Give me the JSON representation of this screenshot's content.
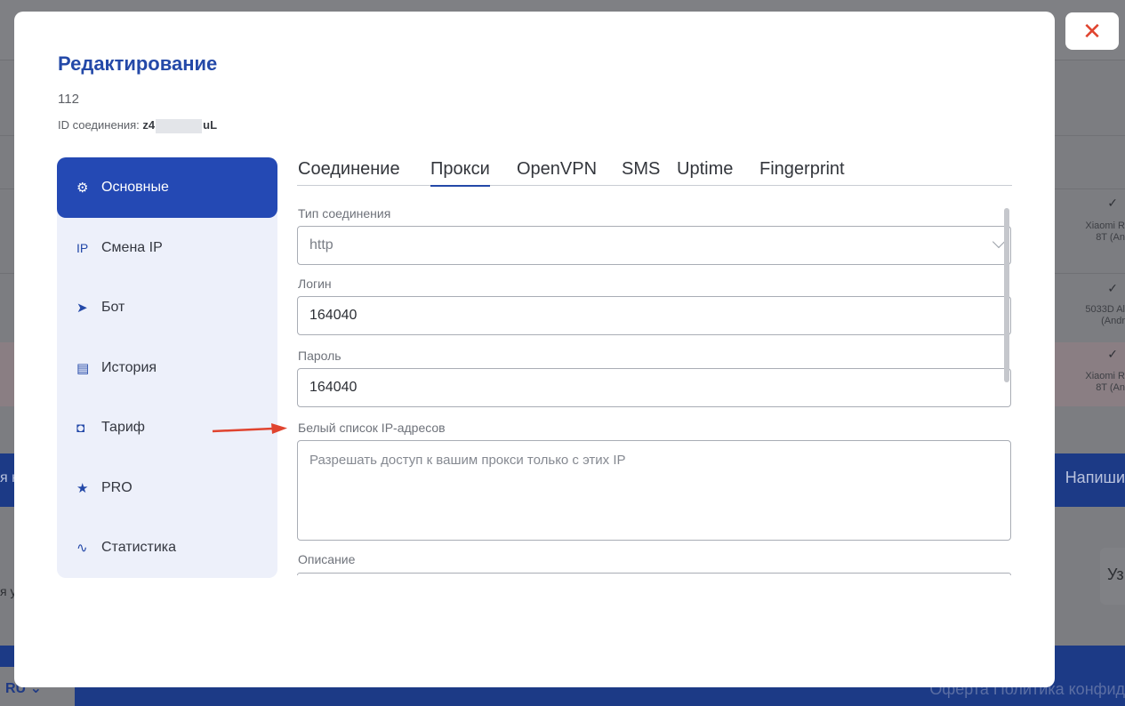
{
  "modal": {
    "title": "Редактирование",
    "number": "112",
    "connection_id_label": "ID соединения:",
    "connection_id_start": "z4",
    "connection_id_end": "uL",
    "close_icon": "close-icon",
    "close_color": "#e0442f"
  },
  "sidebar": {
    "items": [
      {
        "label": "Основные",
        "icon": "gear-icon",
        "glyph": "⚙"
      },
      {
        "label": "Смена IP",
        "icon": "ip-icon",
        "glyph": "IP"
      },
      {
        "label": "Бот",
        "icon": "telegram-icon",
        "glyph": "➤"
      },
      {
        "label": "История",
        "icon": "document-icon",
        "glyph": "▤"
      },
      {
        "label": "Тариф",
        "icon": "shopping-bag-icon",
        "glyph": "◘"
      },
      {
        "label": "PRO",
        "icon": "star-icon",
        "glyph": "★"
      },
      {
        "label": "Статистика",
        "icon": "pulse-icon",
        "glyph": "∿"
      }
    ],
    "active_color": "#2449b4"
  },
  "tabs": [
    {
      "label": "Соединение"
    },
    {
      "label": "Прокси"
    },
    {
      "label": "OpenVPN"
    },
    {
      "label": "SMS"
    },
    {
      "label": "Uptime"
    },
    {
      "label": "Fingerprint"
    }
  ],
  "form": {
    "connection_type_label": "Тип соединения",
    "connection_type_value": "http",
    "login_label": "Логин",
    "login_value": "164040",
    "password_label": "Пароль",
    "password_value": "164040",
    "whitelist_label": "Белый список IP-адресов",
    "whitelist_placeholder": "Разрешать доступ к вашим прокси только с этих IP",
    "description_label": "Описание"
  },
  "background": {
    "device_1": "Xiaomi R 8T (An",
    "device_2": "5033D Al (Andr",
    "device_3": "Xiaomi R 8T (An",
    "write_button": "Напиши",
    "lang": "RU",
    "footer_links": "Оферта  Политика конфид",
    "u_button": "Уз",
    "left_text": "я у",
    "left_text_2": "я н"
  }
}
